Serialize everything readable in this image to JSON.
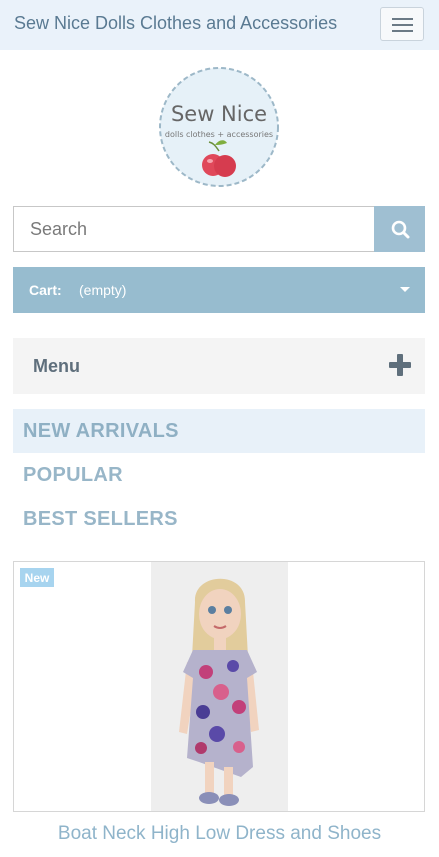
{
  "header": {
    "site_title": "Sew Nice Dolls Clothes and Accessories",
    "menu_toggle_icon": "hamburger-icon"
  },
  "logo": {
    "line1": "Sew Nice",
    "line2": "dolls clothes + accessories"
  },
  "search": {
    "placeholder": "Search",
    "value": "",
    "icon": "search-icon"
  },
  "cart": {
    "label": "Cart:",
    "status": "(empty)",
    "icon": "caret-down-icon"
  },
  "menu": {
    "label": "Menu",
    "icon": "plus-icon"
  },
  "tabs": [
    {
      "label": "NEW ARRIVALS",
      "active": true
    },
    {
      "label": "POPULAR",
      "active": false
    },
    {
      "label": "BEST SELLERS",
      "active": false
    }
  ],
  "product": {
    "badge": "New",
    "name": "Boat Neck High Low Dress and Shoes"
  },
  "colors": {
    "accent": "#97bccf",
    "header_bg": "#eaf2fa",
    "tab_text": "#98b6c8",
    "badge": "#a7d4ef"
  }
}
